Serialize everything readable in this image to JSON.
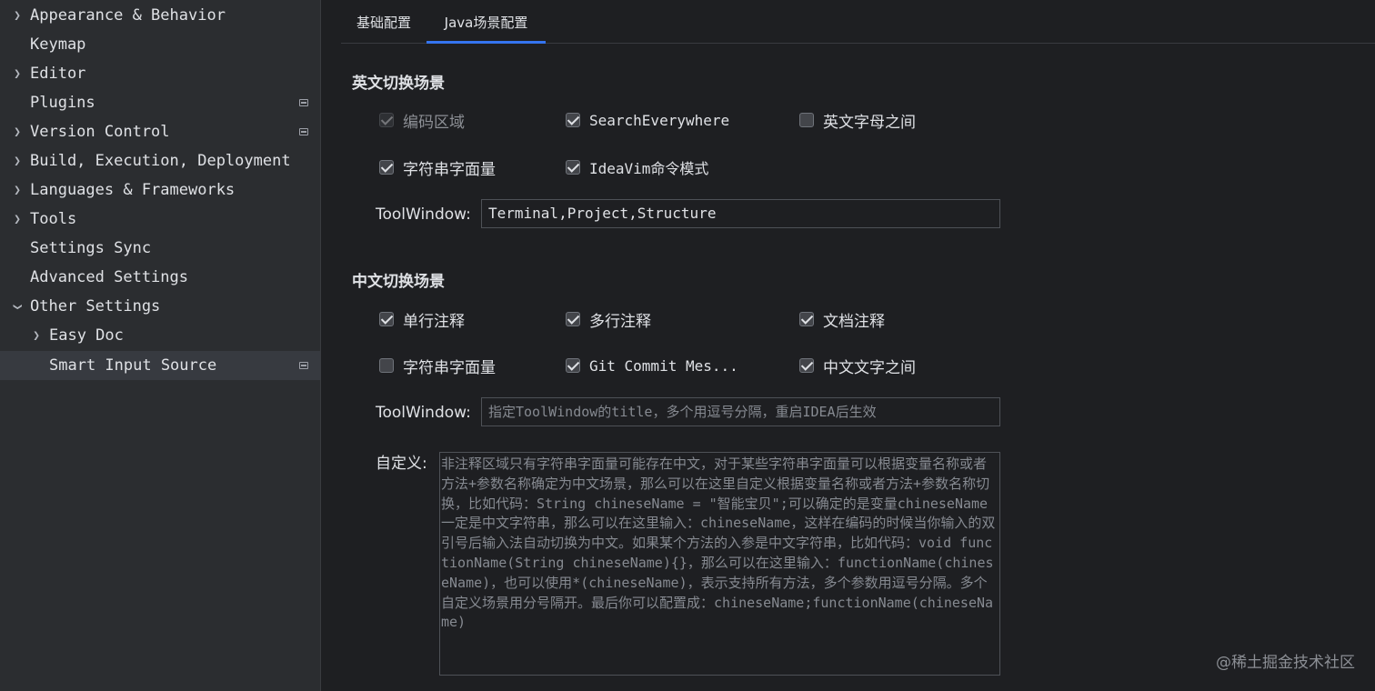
{
  "sidebar": {
    "items": [
      {
        "label": "Appearance & Behavior",
        "expandable": true,
        "expanded": false,
        "page_icon": false
      },
      {
        "label": "Keymap",
        "expandable": false,
        "page_icon": false
      },
      {
        "label": "Editor",
        "expandable": true,
        "expanded": false,
        "page_icon": false
      },
      {
        "label": "Plugins",
        "expandable": false,
        "page_icon": true
      },
      {
        "label": "Version Control",
        "expandable": true,
        "expanded": false,
        "page_icon": true
      },
      {
        "label": "Build, Execution, Deployment",
        "expandable": true,
        "expanded": false,
        "page_icon": false
      },
      {
        "label": "Languages & Frameworks",
        "expandable": true,
        "expanded": false,
        "page_icon": false
      },
      {
        "label": "Tools",
        "expandable": true,
        "expanded": false,
        "page_icon": false
      },
      {
        "label": "Settings Sync",
        "expandable": false,
        "page_icon": false
      },
      {
        "label": "Advanced Settings",
        "expandable": false,
        "page_icon": false
      },
      {
        "label": "Other Settings",
        "expandable": true,
        "expanded": true,
        "page_icon": false
      },
      {
        "label": "Easy Doc",
        "expandable": true,
        "expanded": false,
        "page_icon": false
      },
      {
        "label": "Smart Input Source",
        "expandable": false,
        "page_icon": true,
        "selected": true
      }
    ]
  },
  "tabs": [
    {
      "label": "基础配置",
      "active": false
    },
    {
      "label": "Java场景配置",
      "active": true
    }
  ],
  "english": {
    "title": "英文切换场景",
    "checkboxes": [
      {
        "label": "编码区域",
        "checked": true,
        "disabled": true
      },
      {
        "label": "SearchEverywhere",
        "checked": true,
        "disabled": false
      },
      {
        "label": "英文字母之间",
        "checked": false,
        "disabled": false
      },
      {
        "label": "字符串字面量",
        "checked": true,
        "disabled": false
      },
      {
        "label": "IdeaVim命令模式",
        "checked": true,
        "disabled": false
      }
    ],
    "toolwindow_label": "ToolWindow:",
    "toolwindow_value": "Terminal,Project,Structure"
  },
  "chinese": {
    "title": "中文切换场景",
    "checkboxes": [
      {
        "label": "单行注释",
        "checked": true,
        "disabled": false
      },
      {
        "label": "多行注释",
        "checked": true,
        "disabled": false
      },
      {
        "label": "文档注释",
        "checked": true,
        "disabled": false
      },
      {
        "label": "字符串字面量",
        "checked": false,
        "disabled": false
      },
      {
        "label": "Git Commit Mes...",
        "checked": true,
        "disabled": false
      },
      {
        "label": "中文文字之间",
        "checked": true,
        "disabled": false
      }
    ],
    "toolwindow_label": "ToolWindow:",
    "toolwindow_placeholder": "指定ToolWindow的title，多个用逗号分隔，重启IDEA后生效",
    "custom_label": "自定义:",
    "custom_placeholder": "非注释区域只有字符串字面量可能存在中文，对于某些字符串字面量可以根据变量名称或者方法+参数名称确定为中文场景，那么可以在这里自定义根据变量名称或者方法+参数名称切换，比如代码：String chineseName = \"智能宝贝\";可以确定的是变量chineseName一定是中文字符串，那么可以在这里输入：chineseName，这样在编码的时候当你输入的双引号后输入法自动切换为中文。如果某个方法的入参是中文字符串，比如代码：void functionName(String chineseName){}，那么可以在这里输入：functionName(chineseName)，也可以使用*(chineseName)，表示支持所有方法，多个参数用逗号分隔。多个自定义场景用分号隔开。最后你可以配置成：chineseName;functionName(chineseName)"
  },
  "watermark": "@稀土掘金技术社区"
}
